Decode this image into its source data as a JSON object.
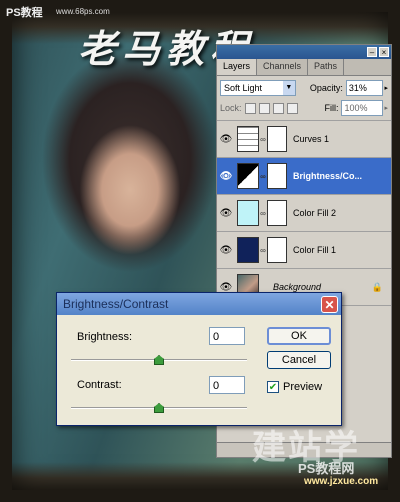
{
  "watermark": {
    "banner": "老马教程",
    "corner_logo": "PS教程",
    "corner_url": "www.68ps.com",
    "big": "建站学",
    "small": "PS教程网",
    "url": "www.jzxue.com"
  },
  "layers_panel": {
    "tabs": [
      "Layers",
      "Channels",
      "Paths"
    ],
    "blend_mode": "Soft Light",
    "opacity_label": "Opacity:",
    "opacity": "31%",
    "lock_label": "Lock:",
    "fill_label": "Fill:",
    "fill": "100%",
    "layers": [
      {
        "name": "Curves 1",
        "selected": false,
        "thumb_color": "#ffffff"
      },
      {
        "name": "Brightness/Co...",
        "selected": true,
        "thumb_color": "#000000"
      },
      {
        "name": "Color Fill 2",
        "selected": false,
        "thumb_color": "#bff3f8"
      },
      {
        "name": "Color Fill 1",
        "selected": false,
        "thumb_color": "#10225a"
      },
      {
        "name": "Background",
        "selected": false,
        "thumb_color": "#8a6a5a"
      }
    ]
  },
  "dialog": {
    "title": "Brightness/Contrast",
    "close": "✕",
    "brightness_label": "Brightness:",
    "brightness_value": "0",
    "contrast_label": "Contrast:",
    "contrast_value": "0",
    "ok_label": "OK",
    "cancel_label": "Cancel",
    "preview_label": "Preview",
    "preview_checked": true,
    "brightness_level": 0.5,
    "contrast_level": 0.5
  },
  "icons": {
    "eye": "eye-icon",
    "chain": "link-icon",
    "lock": "lock-icon",
    "check": "checkmark-icon"
  }
}
